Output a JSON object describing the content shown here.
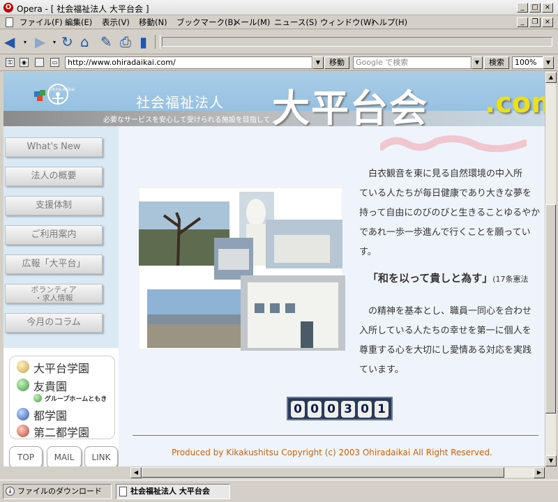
{
  "window": {
    "title": "Opera - [ 社会福祉法人 大平台会 ]",
    "app_logo": "O",
    "controls": [
      "_",
      "□",
      "×"
    ],
    "doc_controls": [
      "_",
      "❐",
      "×"
    ]
  },
  "menubar": {
    "items": [
      "ファイル(F)",
      "編集(E)",
      "表示(V)",
      "移動(N)",
      "ブックマーク(B)",
      "メール(M)",
      "ニュース(S)",
      "ウィンドウ(W)",
      "ヘルプ(H)"
    ]
  },
  "navbar": {
    "icons": [
      "back-icon",
      "forward-icon",
      "reload-icon",
      "home-icon",
      "hotlist-icon",
      "print-icon",
      "page-icon"
    ]
  },
  "addressbar": {
    "url": "http://www.ohiradaikai.com/",
    "go_label": "移動",
    "search_placeholder": "Google で検索",
    "search_label": "検索",
    "zoom": "100%"
  },
  "site": {
    "org_type": "社会福祉法人",
    "name": "大平台会",
    "domain": ".com",
    "tagline": "必要なサービスを安心して受けられる施設を目指して",
    "logo_text": "Ohira-daikai",
    "nav": [
      {
        "label": "What's New"
      },
      {
        "label": "法人の概要"
      },
      {
        "label": "支援体制"
      },
      {
        "label": "ご利用案内"
      },
      {
        "label": "広報「大平台」"
      },
      {
        "label": "ボランティア",
        "label2": "・求人情報"
      },
      {
        "label": "今月のコラム"
      }
    ],
    "facilities": [
      {
        "label": "大平台学園",
        "color": "#c9a24a"
      },
      {
        "label": "友貴園",
        "color": "#3f9b43"
      },
      {
        "label": "グループホームともき",
        "color": "#3f9b43"
      },
      {
        "label": "都学園",
        "color": "#2c5aa8"
      },
      {
        "label": "第二都学園",
        "color": "#b3453a"
      }
    ],
    "small_buttons": [
      "TOP",
      "MAIL",
      "LINK"
    ],
    "intro_lines": [
      "白衣観音を東に見る自然環境の中入所",
      "ている人たちが毎日健康であり大きな夢を",
      "持って自由にのびのびと生きることゆるやか",
      "であれ一歩一歩進んで行くことを願ってい",
      "す。"
    ],
    "quote": "「和を以って貴しと為す」",
    "quote_note": "(17条憲法",
    "body_lines": [
      "の精神を基本とし、職員一同心を合わせ",
      "入所している人たちの幸せを第一に個人を",
      "尊重する心を大切にし愛情ある対応を実践",
      "ています。"
    ],
    "counter": [
      "0",
      "0",
      "0",
      "3",
      "0",
      "1"
    ],
    "copyright": "Produced by Kikakushitsu Copyright (c) 2003 Ohiradaikai All Right Reserved."
  },
  "statusbar": {
    "downloads_label": "ファイルのダウンロード",
    "tab_label": "社会福祉法人 大平台会"
  },
  "colors": {
    "header_blue": "#a9cde7",
    "footer_orange": "#c86414",
    "counter_bg": "#2b3b57"
  }
}
